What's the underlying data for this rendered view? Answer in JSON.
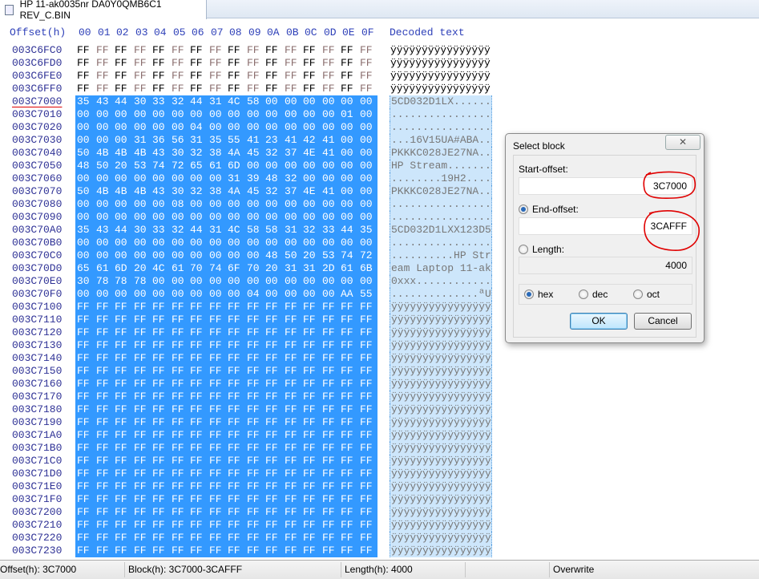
{
  "tab": {
    "title": "HP 11-ak0035nr DA0Y0QMB6C1 REV_C.BIN"
  },
  "header": {
    "offset": "Offset(h)",
    "columns": [
      "00",
      "01",
      "02",
      "03",
      "04",
      "05",
      "06",
      "07",
      "08",
      "09",
      "0A",
      "0B",
      "0C",
      "0D",
      "0E",
      "0F"
    ],
    "decoded": "Decoded text"
  },
  "selection_start": "003C7000",
  "rows": [
    {
      "offset": "003C6FC0",
      "hex": "FF FF FF FF FF FF FF FF FF FF FF FF FF FF FF FF",
      "text": "ÿÿÿÿÿÿÿÿÿÿÿÿÿÿÿÿ"
    },
    {
      "offset": "003C6FD0",
      "hex": "FF FF FF FF FF FF FF FF FF FF FF FF FF FF FF FF",
      "text": "ÿÿÿÿÿÿÿÿÿÿÿÿÿÿÿÿ"
    },
    {
      "offset": "003C6FE0",
      "hex": "FF FF FF FF FF FF FF FF FF FF FF FF FF FF FF FF",
      "text": "ÿÿÿÿÿÿÿÿÿÿÿÿÿÿÿÿ"
    },
    {
      "offset": "003C6FF0",
      "hex": "FF FF FF FF FF FF FF FF FF FF FF FF FF FF FF FF",
      "text": "ÿÿÿÿÿÿÿÿÿÿÿÿÿÿÿÿ"
    },
    {
      "offset": "003C7000",
      "hex": "35 43 44 30 33 32 44 31 4C 58 00 00 00 00 00 00",
      "text": "5CD032D1LX......"
    },
    {
      "offset": "003C7010",
      "hex": "00 00 00 00 00 00 00 00 00 00 00 00 00 00 01 00",
      "text": "................"
    },
    {
      "offset": "003C7020",
      "hex": "00 00 00 00 00 00 04 00 00 00 00 00 00 00 00 00",
      "text": "................"
    },
    {
      "offset": "003C7030",
      "hex": "00 00 00 31 36 56 31 35 55 41 23 41 42 41 00 00",
      "text": "...16V15UA#ABA.."
    },
    {
      "offset": "003C7040",
      "hex": "50 4B 4B 4B 43 30 32 38 4A 45 32 37 4E 41 00 00",
      "text": "PKKKC028JE27NA.."
    },
    {
      "offset": "003C7050",
      "hex": "48 50 20 53 74 72 65 61 6D 00 00 00 00 00 00 00",
      "text": "HP Stream......."
    },
    {
      "offset": "003C7060",
      "hex": "00 00 00 00 00 00 00 00 31 39 48 32 00 00 00 00",
      "text": "........19H2...."
    },
    {
      "offset": "003C7070",
      "hex": "50 4B 4B 4B 43 30 32 38 4A 45 32 37 4E 41 00 00",
      "text": "PKKKC028JE27NA.."
    },
    {
      "offset": "003C7080",
      "hex": "00 00 00 00 00 08 00 00 00 00 00 00 00 00 00 00",
      "text": "................"
    },
    {
      "offset": "003C7090",
      "hex": "00 00 00 00 00 00 00 00 00 00 00 00 00 00 00 00",
      "text": "................"
    },
    {
      "offset": "003C70A0",
      "hex": "35 43 44 30 33 32 44 31 4C 58 58 31 32 33 44 35",
      "text": "5CD032D1LXX123D5"
    },
    {
      "offset": "003C70B0",
      "hex": "00 00 00 00 00 00 00 00 00 00 00 00 00 00 00 00",
      "text": "................"
    },
    {
      "offset": "003C70C0",
      "hex": "00 00 00 00 00 00 00 00 00 00 48 50 20 53 74 72",
      "text": "..........HP Str"
    },
    {
      "offset": "003C70D0",
      "hex": "65 61 6D 20 4C 61 70 74 6F 70 20 31 31 2D 61 6B",
      "text": "eam Laptop 11-ak"
    },
    {
      "offset": "003C70E0",
      "hex": "30 78 78 78 00 00 00 00 00 00 00 00 00 00 00 00",
      "text": "0xxx............"
    },
    {
      "offset": "003C70F0",
      "hex": "00 00 00 00 00 00 00 00 00 04 00 00 00 00 AA 55",
      "text": "..............ªU"
    },
    {
      "offset": "003C7100",
      "hex": "FF FF FF FF FF FF FF FF FF FF FF FF FF FF FF FF",
      "text": "ÿÿÿÿÿÿÿÿÿÿÿÿÿÿÿÿ"
    },
    {
      "offset": "003C7110",
      "hex": "FF FF FF FF FF FF FF FF FF FF FF FF FF FF FF FF",
      "text": "ÿÿÿÿÿÿÿÿÿÿÿÿÿÿÿÿ"
    },
    {
      "offset": "003C7120",
      "hex": "FF FF FF FF FF FF FF FF FF FF FF FF FF FF FF FF",
      "text": "ÿÿÿÿÿÿÿÿÿÿÿÿÿÿÿÿ"
    },
    {
      "offset": "003C7130",
      "hex": "FF FF FF FF FF FF FF FF FF FF FF FF FF FF FF FF",
      "text": "ÿÿÿÿÿÿÿÿÿÿÿÿÿÿÿÿ"
    },
    {
      "offset": "003C7140",
      "hex": "FF FF FF FF FF FF FF FF FF FF FF FF FF FF FF FF",
      "text": "ÿÿÿÿÿÿÿÿÿÿÿÿÿÿÿÿ"
    },
    {
      "offset": "003C7150",
      "hex": "FF FF FF FF FF FF FF FF FF FF FF FF FF FF FF FF",
      "text": "ÿÿÿÿÿÿÿÿÿÿÿÿÿÿÿÿ"
    },
    {
      "offset": "003C7160",
      "hex": "FF FF FF FF FF FF FF FF FF FF FF FF FF FF FF FF",
      "text": "ÿÿÿÿÿÿÿÿÿÿÿÿÿÿÿÿ"
    },
    {
      "offset": "003C7170",
      "hex": "FF FF FF FF FF FF FF FF FF FF FF FF FF FF FF FF",
      "text": "ÿÿÿÿÿÿÿÿÿÿÿÿÿÿÿÿ"
    },
    {
      "offset": "003C7180",
      "hex": "FF FF FF FF FF FF FF FF FF FF FF FF FF FF FF FF",
      "text": "ÿÿÿÿÿÿÿÿÿÿÿÿÿÿÿÿ"
    },
    {
      "offset": "003C7190",
      "hex": "FF FF FF FF FF FF FF FF FF FF FF FF FF FF FF FF",
      "text": "ÿÿÿÿÿÿÿÿÿÿÿÿÿÿÿÿ"
    },
    {
      "offset": "003C71A0",
      "hex": "FF FF FF FF FF FF FF FF FF FF FF FF FF FF FF FF",
      "text": "ÿÿÿÿÿÿÿÿÿÿÿÿÿÿÿÿ"
    },
    {
      "offset": "003C71B0",
      "hex": "FF FF FF FF FF FF FF FF FF FF FF FF FF FF FF FF",
      "text": "ÿÿÿÿÿÿÿÿÿÿÿÿÿÿÿÿ"
    },
    {
      "offset": "003C71C0",
      "hex": "FF FF FF FF FF FF FF FF FF FF FF FF FF FF FF FF",
      "text": "ÿÿÿÿÿÿÿÿÿÿÿÿÿÿÿÿ"
    },
    {
      "offset": "003C71D0",
      "hex": "FF FF FF FF FF FF FF FF FF FF FF FF FF FF FF FF",
      "text": "ÿÿÿÿÿÿÿÿÿÿÿÿÿÿÿÿ"
    },
    {
      "offset": "003C71E0",
      "hex": "FF FF FF FF FF FF FF FF FF FF FF FF FF FF FF FF",
      "text": "ÿÿÿÿÿÿÿÿÿÿÿÿÿÿÿÿ"
    },
    {
      "offset": "003C71F0",
      "hex": "FF FF FF FF FF FF FF FF FF FF FF FF FF FF FF FF",
      "text": "ÿÿÿÿÿÿÿÿÿÿÿÿÿÿÿÿ"
    },
    {
      "offset": "003C7200",
      "hex": "FF FF FF FF FF FF FF FF FF FF FF FF FF FF FF FF",
      "text": "ÿÿÿÿÿÿÿÿÿÿÿÿÿÿÿÿ"
    },
    {
      "offset": "003C7210",
      "hex": "FF FF FF FF FF FF FF FF FF FF FF FF FF FF FF FF",
      "text": "ÿÿÿÿÿÿÿÿÿÿÿÿÿÿÿÿ"
    },
    {
      "offset": "003C7220",
      "hex": "FF FF FF FF FF FF FF FF FF FF FF FF FF FF FF FF",
      "text": "ÿÿÿÿÿÿÿÿÿÿÿÿÿÿÿÿ"
    },
    {
      "offset": "003C7230",
      "hex": "FF FF FF FF FF FF FF FF FF FF FF FF FF FF FF FF",
      "text": "ÿÿÿÿÿÿÿÿÿÿÿÿÿÿÿÿ"
    }
  ],
  "dialog": {
    "title": "Select block",
    "close": "✕",
    "start_label": "Start-offset:",
    "start_value": "3C7000",
    "end_label": "End-offset:",
    "end_value": "3CAFFF",
    "length_label": "Length:",
    "length_value": "4000",
    "base_hex": "hex",
    "base_dec": "dec",
    "base_oct": "oct",
    "ok": "OK",
    "cancel": "Cancel"
  },
  "status": {
    "offset": "Offset(h): 3C7000",
    "block": "Block(h): 3C7000-3CAFFF",
    "length": "Length(h): 4000",
    "mode": "Overwrite"
  },
  "colors": {
    "selection": "#3399ff",
    "decoded_selection": "#cde6fb",
    "offset_text": "#2f3296",
    "annotation": "#e00000"
  }
}
